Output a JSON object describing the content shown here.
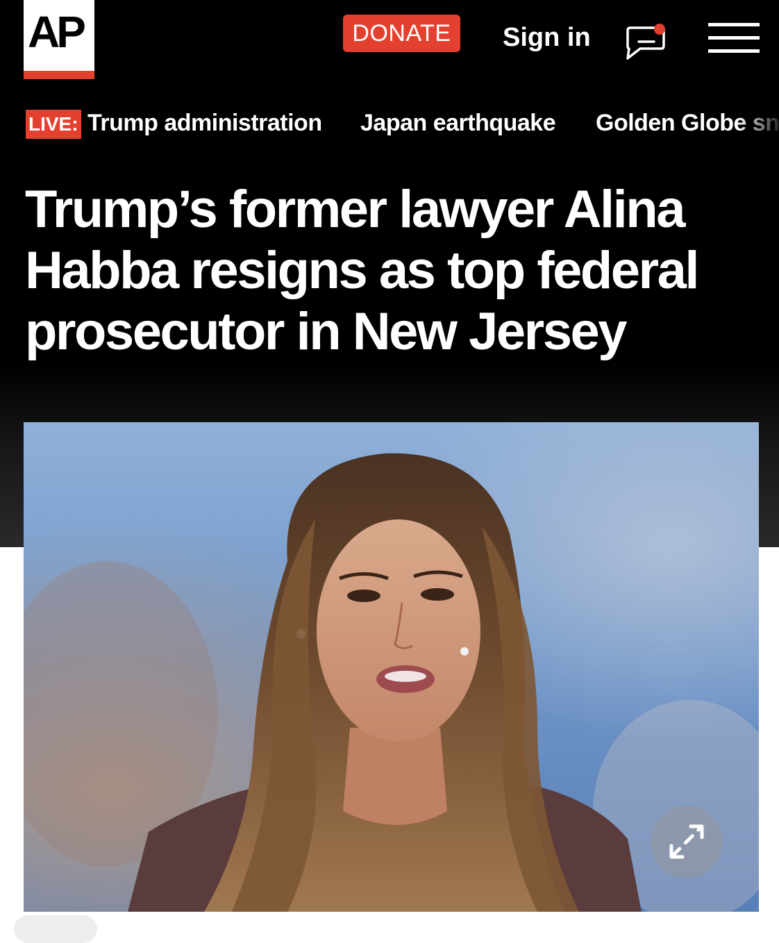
{
  "header": {
    "logo_text": "AP",
    "donate_label": "DONATE",
    "signin_label": "Sign in",
    "icons": [
      "chat-icon",
      "menu-icon",
      "expand-icon"
    ]
  },
  "nav": {
    "live_badge": "LIVE:",
    "items": [
      "Trump administration",
      "Japan earthquake",
      "Golden Globe snu"
    ]
  },
  "article": {
    "headline": "Trump’s former lawyer Alina Habba resigns as top federal prosecutor in New Jersey"
  },
  "colors": {
    "accent": "#e4402f",
    "background": "#000000",
    "text": "#ffffff"
  }
}
